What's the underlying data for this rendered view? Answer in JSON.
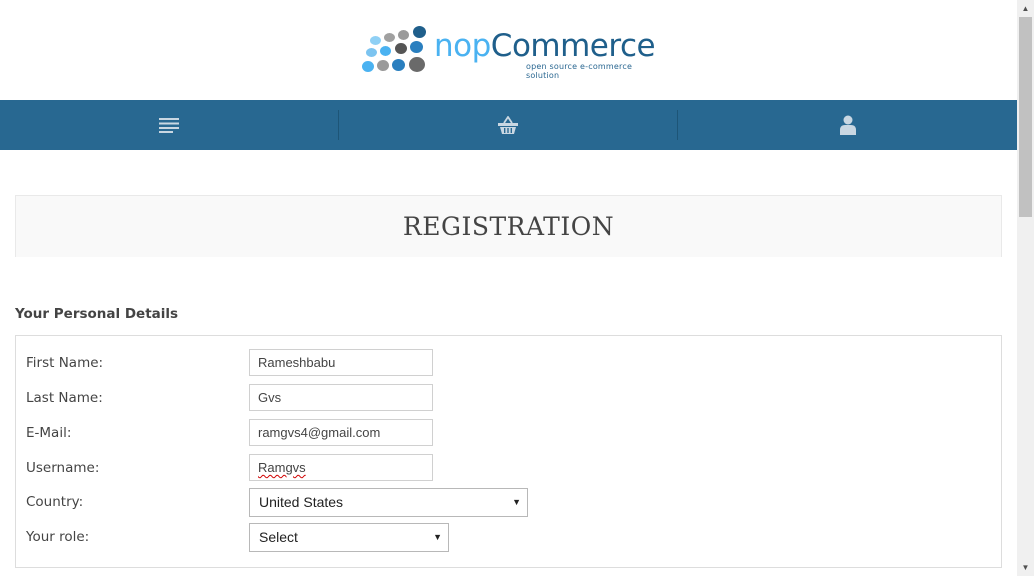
{
  "brand": {
    "name_part1": "nop",
    "name_part2": "Commerce",
    "tagline": "open source e-commerce solution"
  },
  "navbar": {
    "items": [
      {
        "icon": "menu-icon"
      },
      {
        "icon": "shopping-basket-icon"
      },
      {
        "icon": "user-icon"
      }
    ],
    "background": "#286891",
    "icon_color": "#c9d7e2"
  },
  "page": {
    "title": "REGISTRATION",
    "section_title": "Your Personal Details"
  },
  "form": {
    "first_name": {
      "label": "First Name:",
      "value": "Rameshbabu"
    },
    "last_name": {
      "label": "Last Name:",
      "value": "Gvs"
    },
    "email": {
      "label": "E-Mail:",
      "value": "ramgvs4@gmail.com"
    },
    "username": {
      "label": "Username:",
      "value": "Ramgvs"
    },
    "country": {
      "label": "Country:",
      "value": "United States"
    },
    "role": {
      "label": "Your role:",
      "value": "Select"
    }
  }
}
